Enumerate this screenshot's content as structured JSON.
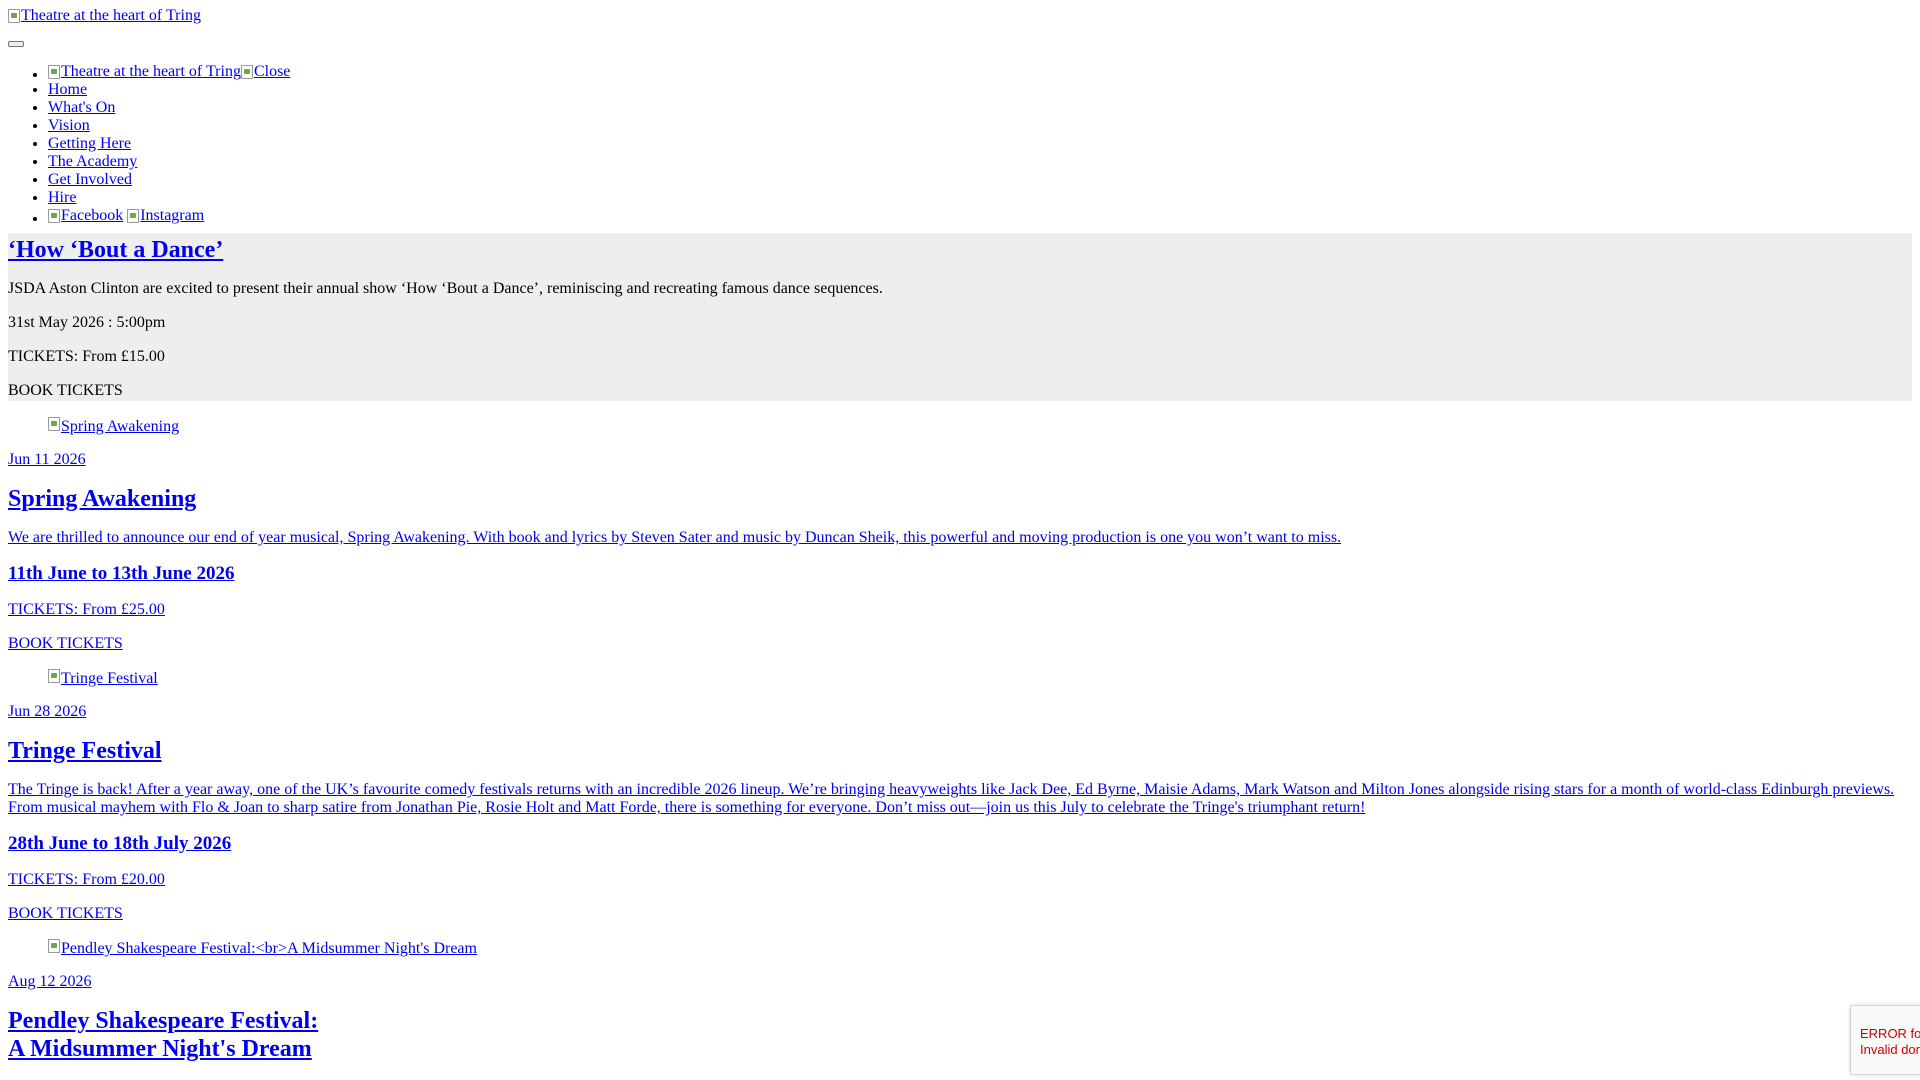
{
  "header": {
    "logo_alt": "Theatre at the heart of Tring"
  },
  "menu": {
    "logo_alt": "Theatre at the heart of Tring",
    "close_alt": "Close",
    "items": [
      "Home",
      "What's On",
      "Vision",
      "Getting Here",
      "The Academy",
      "Get Involved",
      "Hire"
    ],
    "social": [
      "Facebook",
      "Instagram"
    ]
  },
  "featured": {
    "title": "‘How ‘Bout a Dance’",
    "description": "JSDA Aston Clinton are excited to present their annual show ‘How ‘Bout a Dance’, reminiscing and recreating famous dance sequences.",
    "datetime": "31st May 2026 : 5:00pm",
    "tickets": "TICKETS: From £15.00",
    "book": "BOOK TICKETS"
  },
  "events": [
    {
      "image_alt": "Spring Awakening",
      "date_short": "Jun 11 2026",
      "title": "Spring Awakening",
      "description": "We are thrilled to announce our end of year musical, Spring Awakening. With book and lyrics by Steven Sater and music by Duncan Sheik, this powerful and moving production is one you won’t want to miss.",
      "range": "11th June to 13th June 2026",
      "tickets": "TICKETS: From £25.00",
      "book": "BOOK TICKETS"
    },
    {
      "image_alt": "Tringe Festival",
      "date_short": "Jun 28 2026",
      "title": "Tringe Festival",
      "description": "The Tringe is back! After a year away, one of the UK’s favourite comedy festivals returns with an incredible 2026 lineup. We’re bringing heavyweights like Jack Dee, Ed Byrne, Maisie Adams, Mark Watson and Milton Jones alongside rising stars for a month of world-class Edinburgh previews. From musical mayhem with Flo & Joan to sharp satire from Jonathan Pie, Rosie Holt and Matt Forde, there is something for everyone. Don’t miss out—join us this July to celebrate the Tringe's triumphant return!",
      "range": "28th June to 18th July 2026",
      "tickets": "TICKETS: From £20.00",
      "book": "BOOK TICKETS"
    },
    {
      "image_alt": "Pendley Shakespeare Festival:<br>A Midsummer Night's Dream",
      "date_short": "Aug 12 2026",
      "title_line1": "Pendley Shakespeare Festival:",
      "title_line2": "A Midsummer Night's Dream"
    }
  ],
  "recaptcha": {
    "line1": "ERROR for site owner:",
    "line2": "Invalid domain for site key"
  }
}
